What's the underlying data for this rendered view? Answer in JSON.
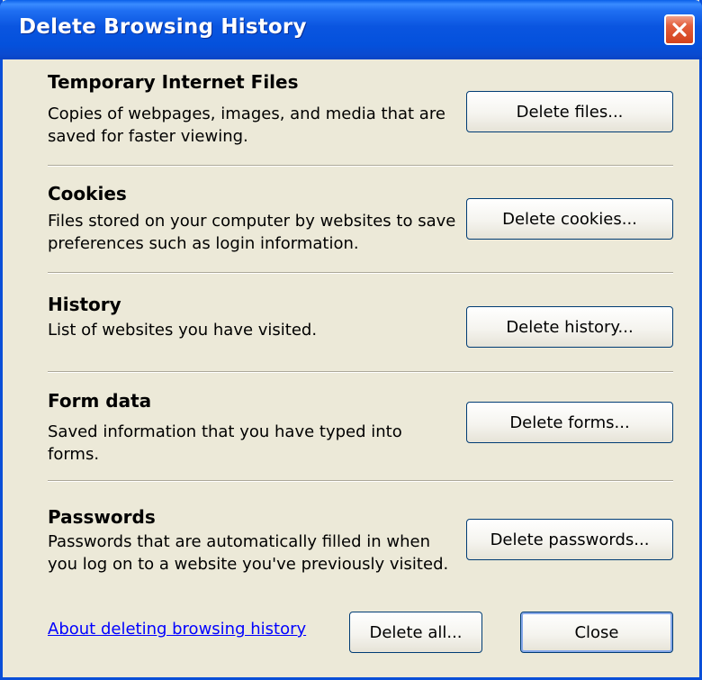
{
  "window": {
    "title": "Delete Browsing History",
    "close_icon": "close-icon"
  },
  "sections": [
    {
      "title": "Temporary Internet Files",
      "description": "Copies of webpages, images, and media that are saved for faster viewing.",
      "button_label": "Delete files..."
    },
    {
      "title": "Cookies",
      "description": "Files stored on your computer by websites to save preferences such as login information.",
      "button_label": "Delete cookies..."
    },
    {
      "title": "History",
      "description": "List of websites you have visited.",
      "button_label": "Delete history..."
    },
    {
      "title": "Form data",
      "description": "Saved information that you have typed into forms.",
      "button_label": "Delete forms..."
    },
    {
      "title": "Passwords",
      "description": "Passwords that are automatically filled in when you log on to a website you've previously visited.",
      "button_label": "Delete passwords..."
    }
  ],
  "footer": {
    "help_link": "About deleting browsing history",
    "delete_all_label": "Delete all...",
    "close_label": "Close"
  },
  "colors": {
    "titlebar": "#0a55e0",
    "dialog_background": "#ece9d8",
    "link": "#0000ff",
    "close_button": "#d2421c"
  }
}
